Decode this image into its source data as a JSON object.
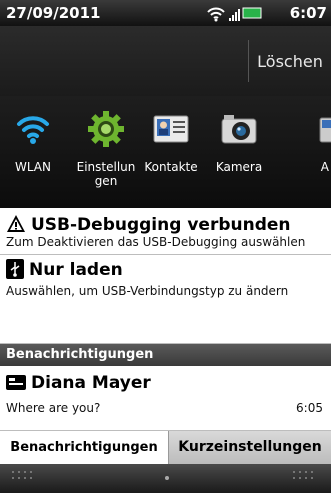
{
  "status_bar": {
    "date": "27/09/2011",
    "time": "6:07",
    "icons": [
      "wifi-icon",
      "signal-icon",
      "battery-icon"
    ]
  },
  "header": {
    "clear_button": "Löschen"
  },
  "quick_settings": [
    {
      "icon": "wifi-icon",
      "label": "WLAN"
    },
    {
      "icon": "gear-icon",
      "label": "Einstellungen"
    },
    {
      "icon": "contacts-icon",
      "label": "Kontakte"
    },
    {
      "icon": "camera-icon",
      "label": "Kamera"
    },
    {
      "icon": "app-icon",
      "label": "A"
    }
  ],
  "notifications": [
    {
      "icon": "warning-icon",
      "title": "USB-Debugging verbunden",
      "subtitle": "Zum Deaktivieren das USB-Debugging auswählen"
    },
    {
      "icon": "usb-icon",
      "title": "Nur laden",
      "subtitle": "Auswählen, um USB-Verbindungstyp zu ändern"
    }
  ],
  "section_header": "Benachrichtigungen",
  "message": {
    "icon": "message-icon",
    "title": "Diana Mayer",
    "subtitle": "Where are you?",
    "time": "6:05"
  },
  "tabs": [
    {
      "label": "Benachrichtigungen",
      "active": true
    },
    {
      "label": "Kurzeinstellungen",
      "active": false
    }
  ],
  "colors": {
    "wifi": "#28a8e8",
    "gear": "#7cc23c",
    "header_bg": "#3c3c3c"
  }
}
